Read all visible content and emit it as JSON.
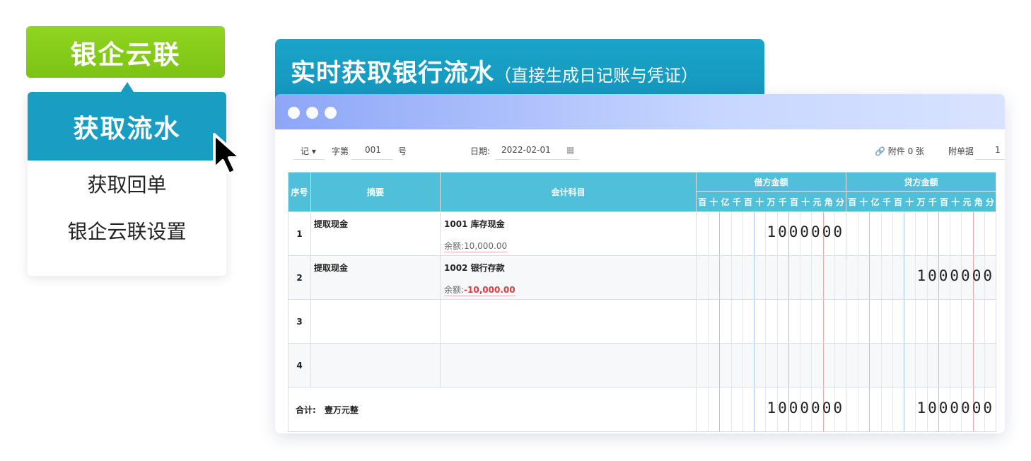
{
  "menu": {
    "brand_label": "银企云联",
    "active_item": "获取流水",
    "items": [
      "获取回单",
      "银企云联设置"
    ]
  },
  "banner": {
    "title": "实时获取银行流水",
    "subtitle": "（直接生成日记账与凭证）"
  },
  "toolbar": {
    "voucher_type": "记",
    "word_label": "字第",
    "number": "001",
    "number_suffix": "号",
    "date_label": "日期:",
    "date_value": "2022-02-01",
    "attachment_label": "附件 0 张",
    "doc_label": "附单据",
    "doc_value": "1"
  },
  "table": {
    "headers": {
      "seq": "序号",
      "summary": "摘要",
      "account": "会计科目",
      "debit": "借方金额",
      "credit": "贷方金额"
    },
    "digit_labels": [
      "百",
      "十",
      "亿",
      "千",
      "百",
      "十",
      "万",
      "千",
      "百",
      "十",
      "元",
      "角",
      "分"
    ],
    "rows": [
      {
        "seq": "1",
        "summary": "提取现金",
        "account": "1001 库存现金",
        "balance_label": "余额:",
        "balance": "10,000.00",
        "debit": "1000000",
        "credit": ""
      },
      {
        "seq": "2",
        "summary": "提取现金",
        "account": "1002 银行存款",
        "balance_label": "余额:",
        "balance": "-10,000.00",
        "debit": "",
        "credit": "1000000"
      },
      {
        "seq": "3",
        "summary": "",
        "account": "",
        "balance_label": "",
        "balance": "",
        "debit": "",
        "credit": ""
      },
      {
        "seq": "4",
        "summary": "",
        "account": "",
        "balance_label": "",
        "balance": "",
        "debit": "",
        "credit": ""
      }
    ],
    "total": {
      "label": "合计:",
      "amount_words": "壹万元整",
      "debit": "1000000",
      "credit": "1000000"
    }
  },
  "colors": {
    "brand_green": "#7cc314",
    "accent_blue": "#1a9dc3",
    "table_header": "#4fbfda",
    "negative_red": "#e23a3a"
  }
}
